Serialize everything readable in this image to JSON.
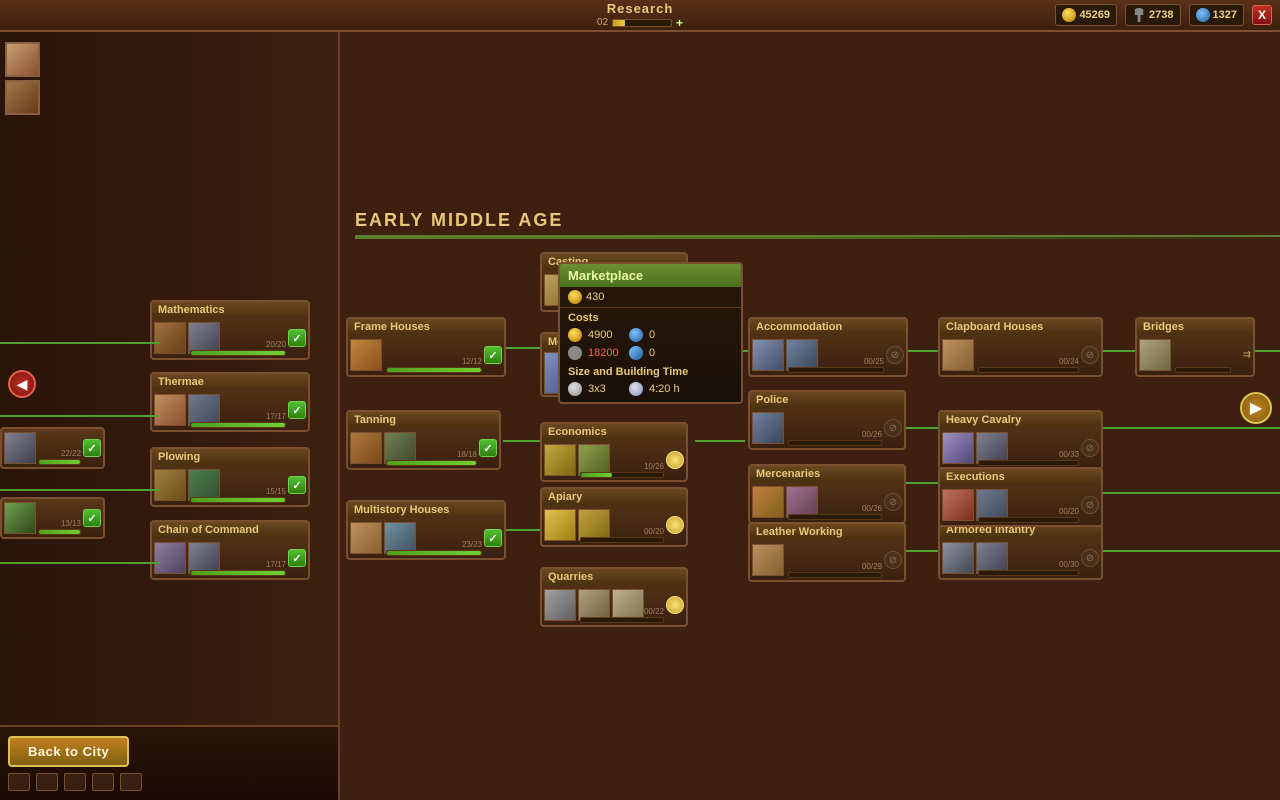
{
  "topbar": {
    "title": "Research",
    "xp_label": "02",
    "xp_plus": "+",
    "gold": "45269",
    "hammers": "2738",
    "population": "1327",
    "close_label": "X"
  },
  "era": {
    "label": "EARLY MIDDLE AGE"
  },
  "back_button": {
    "label": "Back to City"
  },
  "nodes": {
    "mathematics": {
      "label": "Mathematics",
      "progress": "20/20"
    },
    "thermae": {
      "label": "Thermae",
      "progress": "17/17"
    },
    "plowing": {
      "label": "Plowing",
      "progress": "15/15"
    },
    "chain_of_command": {
      "label": "Chain of Command",
      "progress": "17/17"
    },
    "frame_houses": {
      "label": "Frame Houses",
      "progress": "12/12"
    },
    "tanning": {
      "label": "Tanning",
      "progress": "18/18"
    },
    "multistory_houses": {
      "label": "Multistory Houses",
      "progress": "23/23"
    },
    "casting": {
      "label": "Casting",
      "progress": ""
    },
    "mounted": {
      "label": "Mounted",
      "progress": ""
    },
    "economics": {
      "label": "Economics",
      "progress": "10/26"
    },
    "apiary": {
      "label": "Apiary",
      "progress": "00/20"
    },
    "quarries": {
      "label": "Quarries",
      "progress": "00/22"
    },
    "accommodation": {
      "label": "Accommodation",
      "progress": "00/25"
    },
    "police": {
      "label": "Police",
      "progress": "00/26"
    },
    "mercenaries": {
      "label": "Mercenaries",
      "progress": "00/26"
    },
    "leather_working": {
      "label": "Leather Working",
      "progress": "00/29"
    },
    "clapboard_houses": {
      "label": "Clapboard Houses",
      "progress": "00/24"
    },
    "heavy_cavalry": {
      "label": "Heavy Cavalry",
      "progress": "00/33"
    },
    "armored_infantry": {
      "label": "Armored Infantry",
      "progress": "00/30"
    },
    "executions": {
      "label": "Executions",
      "progress": "00/20"
    },
    "bridges": {
      "label": "Bridges",
      "progress": ""
    }
  },
  "tooltip": {
    "title": "Marketplace",
    "gold_cost": "430",
    "costs_label": "Costs",
    "gold_cost2": "4900",
    "people_cost": "0",
    "hammer_cost": "18200",
    "hammer_cost2": "0",
    "size_label": "Size and Building Time",
    "size": "3x3",
    "time": "4:20 h"
  }
}
